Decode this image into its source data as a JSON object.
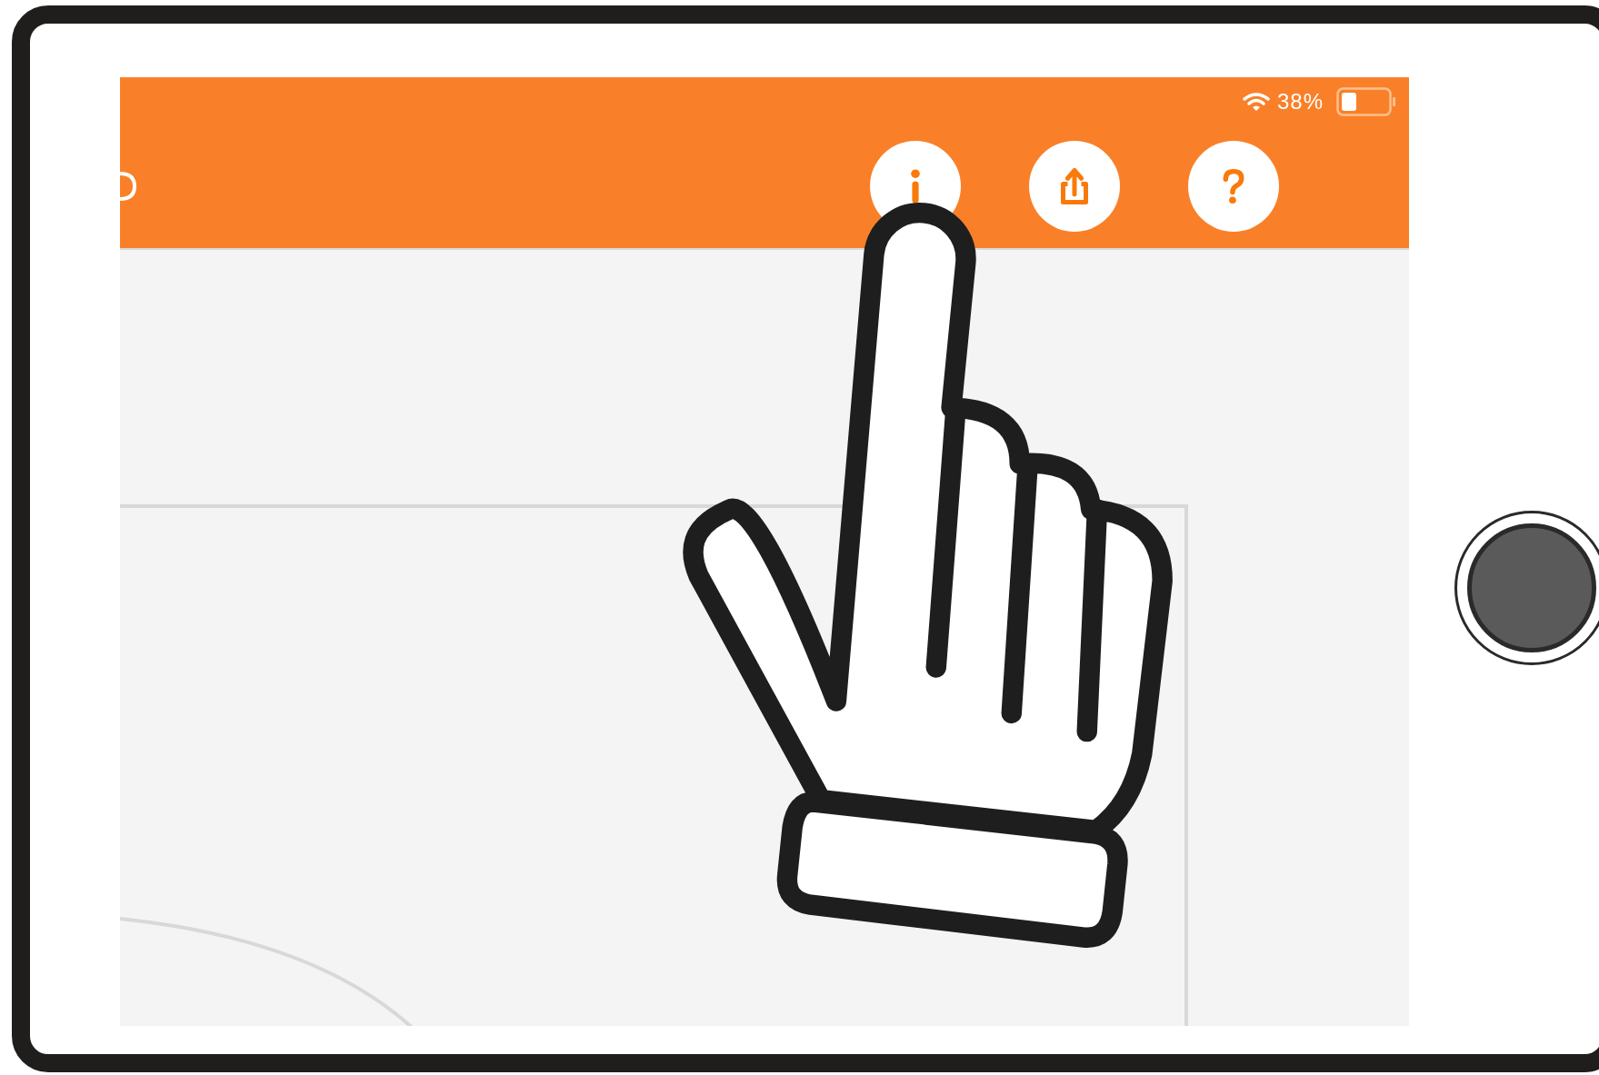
{
  "status_bar": {
    "battery": "38%"
  },
  "toolbar": {
    "buttons": [
      {
        "kind": "info"
      },
      {
        "kind": "share"
      },
      {
        "kind": "help"
      }
    ]
  }
}
